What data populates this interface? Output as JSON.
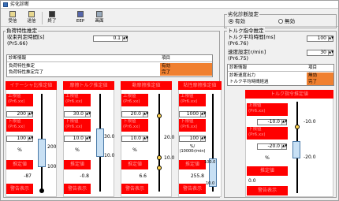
{
  "title": "劣化診断",
  "toolbar": {
    "items": [
      {
        "label": "受信",
        "icon": "receive-icon"
      },
      {
        "label": "送信",
        "icon": "send-icon"
      },
      {
        "label": "終了",
        "icon": "exit-icon"
      },
      {
        "label": "EEP",
        "icon": "eeprom-icon"
      },
      {
        "label": "画面",
        "icon": "screen-icon"
      }
    ]
  },
  "load": {
    "group_title": "負荷特性推定",
    "param_label": "収束判定時間[s]",
    "param_code": "(Pr5.66)",
    "param_value": "0.1",
    "table": {
      "head_left": "診断情報",
      "head_right": "項目",
      "rows": [
        {
          "label": "負荷特性推定",
          "status": "有効"
        },
        {
          "label": "負荷特性推定完了",
          "status": "完了"
        }
      ]
    },
    "panels": [
      {
        "header": "イナーシャ比推定値",
        "upper_label": "上限値",
        "upper_code": "(Pr6.xx)",
        "upper_value": "200",
        "lower_label": "下限値",
        "lower_code": "(Pr6.xx)",
        "lower_value": "100",
        "unit": "%",
        "estimate_label": "推定値",
        "estimate_value": "-87",
        "warn_label": "警告表示",
        "ticks": [
          "200",
          "100"
        ]
      },
      {
        "header": "摩擦トルク推定値",
        "upper_label": "上限値",
        "upper_code": "(Pr6.xx)",
        "upper_value": "30.0",
        "lower_label": "下限値",
        "lower_code": "(Pr6.xx)",
        "lower_value": "10.0",
        "unit": "%",
        "estimate_label": "推定値",
        "estimate_value": "-0.8",
        "warn_label": "警告表示",
        "ticks": [
          "30.0",
          "10.0"
        ]
      },
      {
        "header": "動摩擦推定値",
        "upper_label": "上限値",
        "upper_code": "(Pr6.xx)",
        "upper_value": "20.0",
        "lower_label": "下限値",
        "lower_code": "(Pr6.xx)",
        "lower_value": "10.0",
        "unit": "%",
        "estimate_label": "推定値",
        "estimate_value": "6.6",
        "warn_label": "警告表示",
        "ticks": [
          "20.0",
          "10.0"
        ]
      },
      {
        "header": "粘性摩擦推定値",
        "upper_label": "上限値",
        "upper_code": "(Pr6.xx)",
        "upper_value": "1000",
        "lower_label": "下限値",
        "lower_code": "(Pr6.xx)",
        "lower_value": "100",
        "unit": "%/\n(10000r/min)",
        "estimate_label": "推定値",
        "estimate_value": "255.8",
        "warn_label": "警告表示",
        "ticks": [
          "100.0",
          "10.0"
        ]
      }
    ]
  },
  "degradation": {
    "group_title": "劣化診断設定",
    "options": [
      "有効",
      "無効"
    ],
    "selected": "有効"
  },
  "torque": {
    "group_title": "トルク指令推定",
    "time_label": "トルク平均時間[ms]",
    "time_code": "(Pr6.76)",
    "time_value": "100",
    "speed_label": "速度設定[r/min]",
    "speed_code": "(Pr6.75)",
    "speed_value": "30",
    "table": {
      "head_left": "診断情報",
      "head_right": "項目",
      "rows": [
        {
          "label": "診断速度出力",
          "status": "無効"
        },
        {
          "label": "トルク平均時間経過",
          "status": "完了"
        }
      ]
    },
    "panel": {
      "header": "トルク指令推定値",
      "upper_label": "上限値",
      "upper_code": "(Pr6.xx)",
      "upper_value": "-10.0",
      "lower_label": "下限値",
      "lower_code": "(Pr6.xx)",
      "lower_value": "-20.0",
      "unit": "%",
      "estimate_label": "推定値",
      "estimate_value": "0.0",
      "warn_label": "警告表示",
      "ticks": [
        "-10.0",
        "-20.0"
      ]
    }
  }
}
